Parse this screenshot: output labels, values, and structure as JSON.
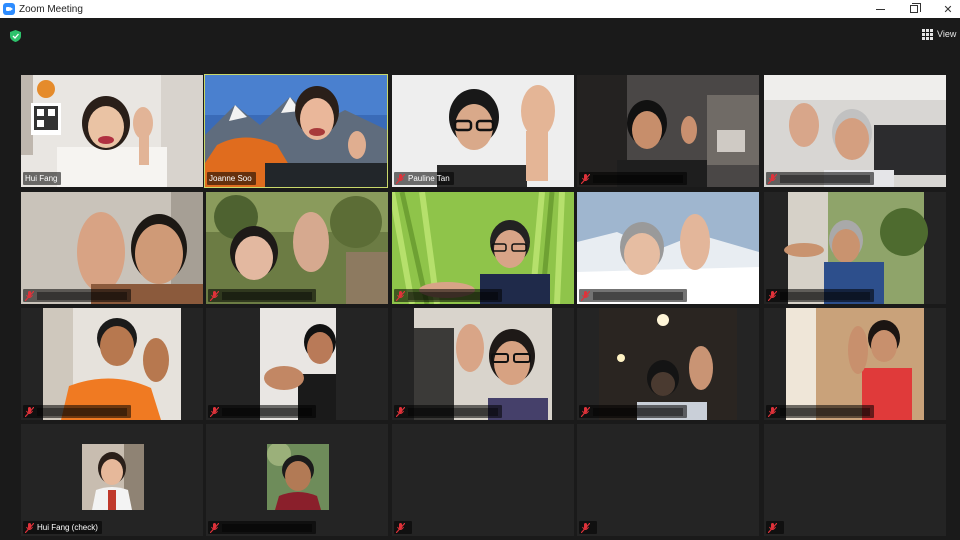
{
  "window": {
    "title": "Zoom Meeting",
    "minimize_glyph": "",
    "close_glyph": "✕"
  },
  "toolbar": {
    "view_label": "View",
    "view_icon": "grid-icon",
    "security_icon": "shield-check-icon",
    "security_color": "#2dc26b"
  },
  "accent": {
    "active_speaker_border": "#c9d86a",
    "muted_mic_color": "#e0323a"
  },
  "participants": [
    {
      "id": "p1",
      "name": "Hui Fang",
      "name_visible": true,
      "muted": false,
      "video": "on"
    },
    {
      "id": "p2",
      "name": "Joanne Soo",
      "name_visible": true,
      "muted": false,
      "video": "on",
      "active_speaker": true
    },
    {
      "id": "p3",
      "name": "Pauline Tan",
      "name_visible": true,
      "muted": true,
      "video": "on"
    },
    {
      "id": "p4",
      "name": "",
      "name_visible": false,
      "muted": true,
      "video": "on"
    },
    {
      "id": "p5",
      "name": "",
      "name_visible": false,
      "muted": true,
      "video": "on"
    },
    {
      "id": "p6",
      "name": "",
      "name_visible": false,
      "muted": true,
      "video": "on"
    },
    {
      "id": "p7",
      "name": "",
      "name_visible": false,
      "muted": true,
      "video": "on"
    },
    {
      "id": "p8",
      "name": "",
      "name_visible": false,
      "muted": true,
      "video": "on"
    },
    {
      "id": "p9",
      "name": "",
      "name_visible": false,
      "muted": true,
      "video": "on"
    },
    {
      "id": "p10",
      "name": "",
      "name_visible": false,
      "muted": true,
      "video": "on"
    },
    {
      "id": "p11",
      "name": "",
      "name_visible": false,
      "muted": true,
      "video": "on"
    },
    {
      "id": "p12",
      "name": "",
      "name_visible": false,
      "muted": true,
      "video": "on"
    },
    {
      "id": "p13",
      "name": "",
      "name_visible": false,
      "muted": true,
      "video": "on"
    },
    {
      "id": "p14",
      "name": "",
      "name_visible": false,
      "muted": true,
      "video": "on"
    },
    {
      "id": "p15",
      "name": "",
      "name_visible": false,
      "muted": true,
      "video": "on"
    },
    {
      "id": "p16",
      "name": "Hui Fang (check)",
      "name_visible": true,
      "muted": true,
      "video": "off"
    },
    {
      "id": "p17",
      "name": "",
      "name_visible": false,
      "muted": true,
      "video": "off"
    },
    {
      "id": "p18",
      "name": "",
      "name_visible": false,
      "muted": true,
      "video": "off"
    },
    {
      "id": "p19",
      "name": "",
      "name_visible": false,
      "muted": true,
      "video": "off"
    },
    {
      "id": "p20",
      "name": "",
      "name_visible": false,
      "muted": true,
      "video": "off"
    }
  ]
}
